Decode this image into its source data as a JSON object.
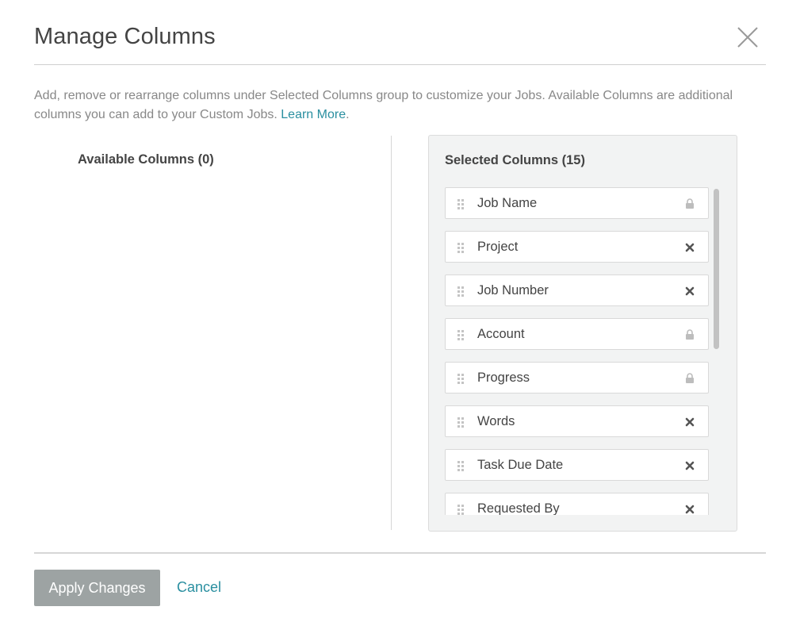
{
  "dialog": {
    "title": "Manage Columns",
    "close_icon": "close-icon",
    "description": "Add, remove or rearrange columns under Selected Columns group to customize your Jobs. Available Columns are additional columns you can add to your Custom Jobs. ",
    "learn_more_label": "Learn More",
    "description_end": "."
  },
  "available": {
    "title": "Available Columns (0)"
  },
  "selected": {
    "title": "Selected Columns (15)",
    "items": [
      {
        "label": "Job Name",
        "action": "lock"
      },
      {
        "label": "Project",
        "action": "remove"
      },
      {
        "label": "Job Number",
        "action": "remove"
      },
      {
        "label": "Account",
        "action": "lock"
      },
      {
        "label": "Progress",
        "action": "lock"
      },
      {
        "label": "Words",
        "action": "remove"
      },
      {
        "label": "Task Due Date",
        "action": "remove"
      },
      {
        "label": "Requested By",
        "action": "remove"
      }
    ]
  },
  "footer": {
    "apply_label": "Apply Changes",
    "cancel_label": "Cancel"
  },
  "colors": {
    "accent": "#2a8fa0",
    "apply_button_bg": "#9da3a3",
    "panel_bg": "#f2f3f3"
  }
}
